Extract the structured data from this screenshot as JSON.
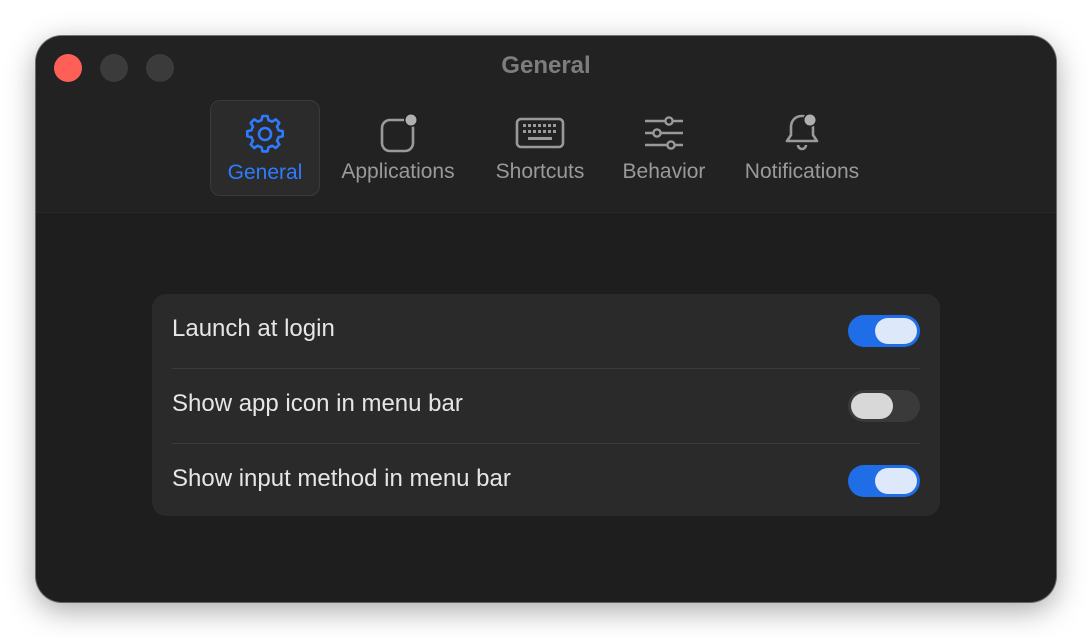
{
  "window": {
    "title": "General"
  },
  "tabs": [
    {
      "label": "General",
      "icon": "gear-icon",
      "active": true
    },
    {
      "label": "Applications",
      "icon": "app-badge-icon",
      "active": false
    },
    {
      "label": "Shortcuts",
      "icon": "keyboard-icon",
      "active": false
    },
    {
      "label": "Behavior",
      "icon": "sliders-icon",
      "active": false
    },
    {
      "label": "Notifications",
      "icon": "bell-badge-icon",
      "active": false
    }
  ],
  "settings": [
    {
      "label": "Launch at login",
      "enabled": true
    },
    {
      "label": "Show app icon in menu bar",
      "enabled": false
    },
    {
      "label": "Show input method in menu bar",
      "enabled": true
    }
  ],
  "colors": {
    "accent": "#2f7bff",
    "toggle_on": "#1f6ee8",
    "close_button": "#fe5f57",
    "window_bg": "#1e1e1e"
  }
}
